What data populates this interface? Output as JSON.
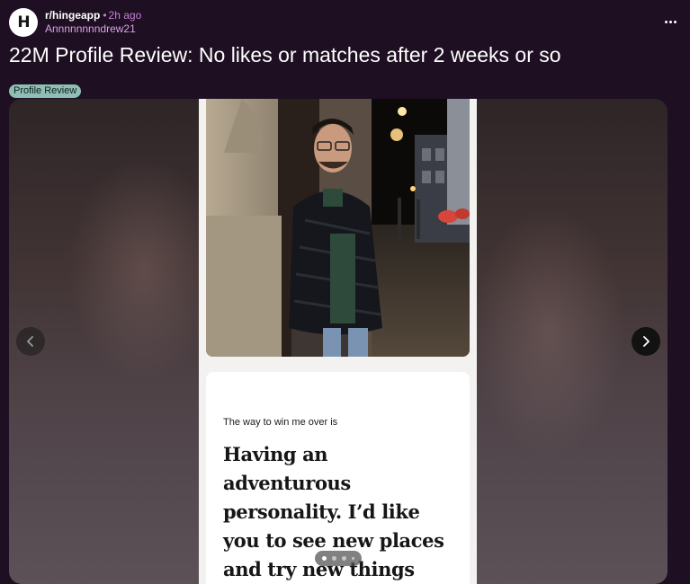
{
  "post": {
    "subreddit": "r/hingeapp",
    "separator": "•",
    "time": "2h ago",
    "author": "Annnnnnnndrew21",
    "title": "22M Profile Review: No likes or matches after 2 weeks or so",
    "flair": "Profile Review",
    "avatar_glyph": "H"
  },
  "gallery": {
    "prompt_question": "The way to win me over is",
    "prompt_answer": "Having an adventurous personality. I’d like you to see new places and try new things with me",
    "total_pages": 4,
    "current_page": 1
  },
  "icons": {
    "more": "more-options-icon",
    "prev": "chevron-left-icon",
    "next": "chevron-right-icon"
  },
  "colors": {
    "background": "#1e0f22",
    "accent_meta": "#c77fd8",
    "flair_bg": "#8fbfb4"
  }
}
